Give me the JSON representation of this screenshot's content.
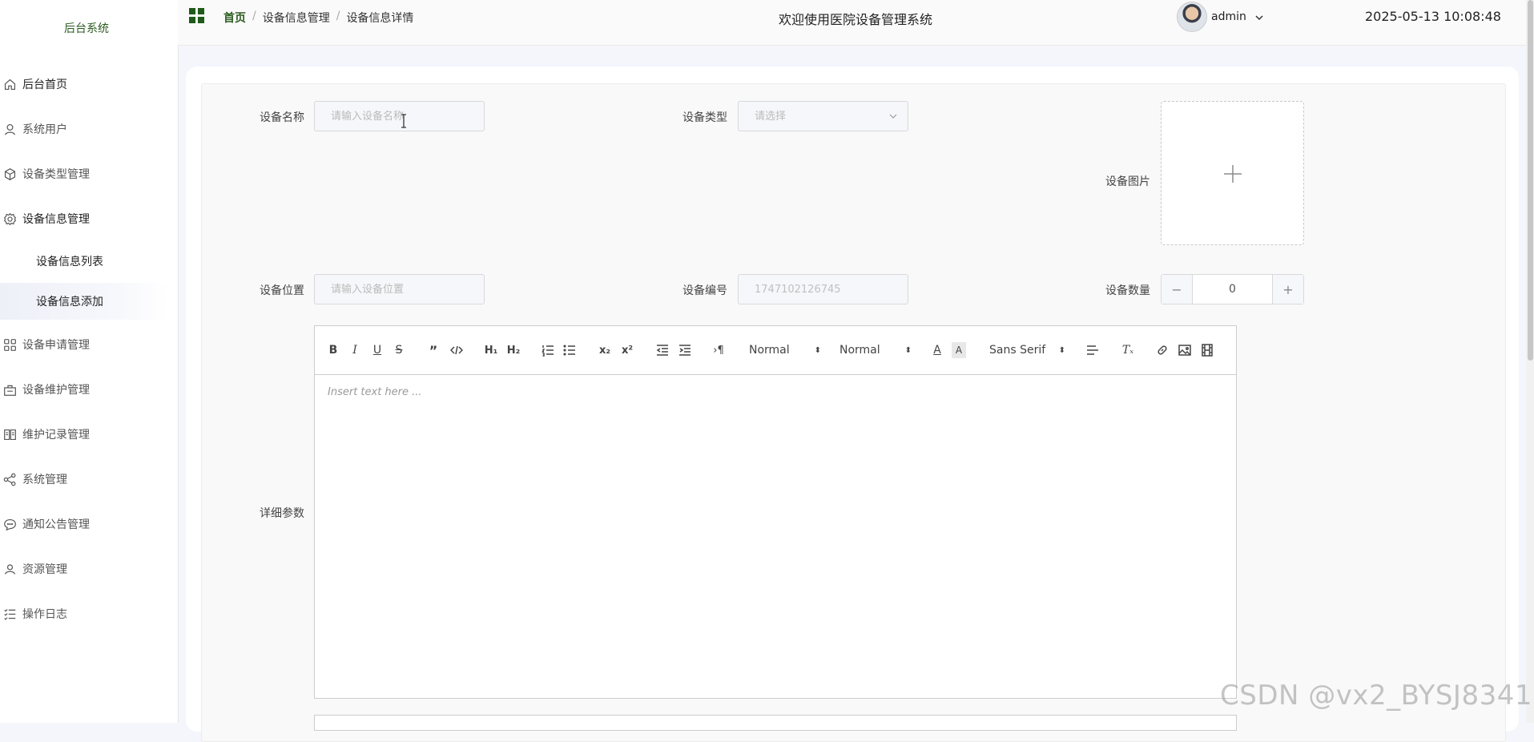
{
  "sidebar": {
    "brand": "后台系统",
    "items": [
      {
        "label": "后台首页",
        "icon": "home-icon"
      },
      {
        "label": "系统用户",
        "icon": "user-icon"
      },
      {
        "label": "设备类型管理",
        "icon": "box-icon"
      },
      {
        "label": "设备信息管理",
        "icon": "gear-icon"
      },
      {
        "label": "设备申请管理",
        "icon": "apps-icon"
      },
      {
        "label": "设备维护管理",
        "icon": "toolbox-icon"
      },
      {
        "label": "维护记录管理",
        "icon": "book-icon"
      },
      {
        "label": "系统管理",
        "icon": "share-icon"
      },
      {
        "label": "通知公告管理",
        "icon": "chat-icon"
      },
      {
        "label": "资源管理",
        "icon": "person-icon"
      },
      {
        "label": "操作日志",
        "icon": "list-icon"
      }
    ],
    "sub_items": [
      {
        "label": "设备信息列表"
      },
      {
        "label": "设备信息添加"
      }
    ]
  },
  "header": {
    "breadcrumb": [
      "首页",
      "设备信息管理",
      "设备信息详情"
    ],
    "welcome": "欢迎使用医院设备管理系统",
    "username": "admin",
    "datetime": "2025-05-13 10:08:48"
  },
  "form": {
    "name_label": "设备名称",
    "name_placeholder": "请输入设备名称",
    "type_label": "设备类型",
    "type_placeholder": "请选择",
    "image_label": "设备图片",
    "location_label": "设备位置",
    "location_placeholder": "请输入设备位置",
    "code_label": "设备编号",
    "code_value": "1747102126745",
    "qty_label": "设备数量",
    "qty_value": "0",
    "qty_minus": "−",
    "qty_plus": "+",
    "details_label": "详细参数"
  },
  "editor": {
    "header_picker": "Normal",
    "size_picker": "Normal",
    "font_picker": "Sans Serif",
    "placeholder": "Insert text here ..."
  },
  "watermark": "CSDN @vx2_BYSJ8341"
}
